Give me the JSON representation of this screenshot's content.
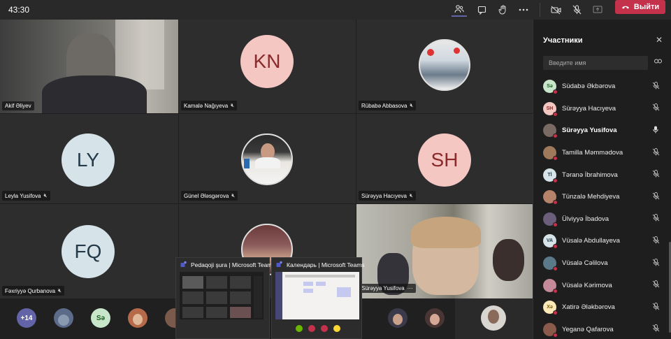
{
  "topbar": {
    "timer": "43:30",
    "icons": [
      "people-icon",
      "chat-icon",
      "raise-hand-icon",
      "more-icon",
      "camera-off-icon",
      "mic-off-icon",
      "share-icon"
    ],
    "leave_label": "Выйти",
    "leave_color": "#c4314b"
  },
  "grid": {
    "tiles": [
      {
        "name": "Akif Əliyev",
        "type": "video"
      },
      {
        "name": "Kamalə Nağıyeva",
        "type": "initials",
        "initials": "KN",
        "color": "#f4c7c3",
        "text_color": "#8b2a2a"
      },
      {
        "name": "Rübabə Abbasova",
        "type": "photo"
      },
      {
        "name": "Leyla Yusifova",
        "type": "initials",
        "initials": "LY",
        "color": "#d6e4ea",
        "text_color": "#243a48"
      },
      {
        "name": "Günel Ələsgərova",
        "type": "photo"
      },
      {
        "name": "Sürəyya Hacıyeva",
        "type": "initials",
        "initials": "SH",
        "color": "#f4c7c3",
        "text_color": "#8b2a2a"
      },
      {
        "name": "Fəxriyyə Qurbanova",
        "type": "initials",
        "initials": "FQ",
        "color": "#d6e4ea",
        "text_color": "#243a48"
      },
      {
        "name": "",
        "type": "photo"
      },
      {
        "name": "Sürəyya Yusifova",
        "type": "video",
        "more": "···"
      }
    ]
  },
  "strip": {
    "overflow_count": "+14",
    "initials": "Sə"
  },
  "previews": [
    {
      "title": "Pedaqoji şura | Microsoft Teams"
    },
    {
      "title": "Календарь | Microsoft Teams"
    }
  ],
  "panel": {
    "title": "Участники",
    "search_placeholder": "Введите имя",
    "participants": [
      {
        "initials": "Sə",
        "name": "Südabə Əkbərova",
        "color": "#c8e6c9",
        "text_color": "#1b5e20",
        "mic": "mic-off-icon"
      },
      {
        "initials": "SH",
        "name": "Sürəyya Hacıyeva",
        "color": "#f4c7c3",
        "text_color": "#8b2a2a",
        "mic": "mic-off-icon"
      },
      {
        "initials": "",
        "name": "Sürəyya Yusifova",
        "color": "#7a6a64",
        "text_color": "#fff",
        "mic": "mic-on-icon",
        "bold": true
      },
      {
        "initials": "",
        "name": "Tamilla Məmmədova",
        "color": "#a0795a",
        "text_color": "#fff",
        "mic": "mic-off-icon"
      },
      {
        "initials": "Tİ",
        "name": "Təranə İbrahimova",
        "color": "#d6e4ea",
        "text_color": "#243a48",
        "mic": "mic-off-icon"
      },
      {
        "initials": "",
        "name": "Tünzalə Mehdiyeva",
        "color": "#b5826a",
        "text_color": "#fff",
        "mic": "mic-off-icon"
      },
      {
        "initials": "",
        "name": "Ülviyyə İbadova",
        "color": "#6a5e7a",
        "text_color": "#fff",
        "mic": "mic-off-icon"
      },
      {
        "initials": "VA",
        "name": "Vüsalə Abdullayeva",
        "color": "#d6e4ea",
        "text_color": "#243a48",
        "mic": "mic-off-icon"
      },
      {
        "initials": "",
        "name": "Vüsalə Cəlilova",
        "color": "#5a7a8a",
        "text_color": "#fff",
        "mic": "mic-off-icon"
      },
      {
        "initials": "",
        "name": "Vüsalə Kərimova",
        "color": "#c48a9a",
        "text_color": "#fff",
        "mic": "mic-off-icon"
      },
      {
        "initials": "Xə",
        "name": "Xatirə Ələkbərova",
        "color": "#fde9b8",
        "text_color": "#7a5a00",
        "mic": "mic-off-icon"
      },
      {
        "initials": "",
        "name": "Yeganə Qafarova",
        "color": "#8a5a4a",
        "text_color": "#fff",
        "mic": "mic-off-icon"
      }
    ]
  }
}
